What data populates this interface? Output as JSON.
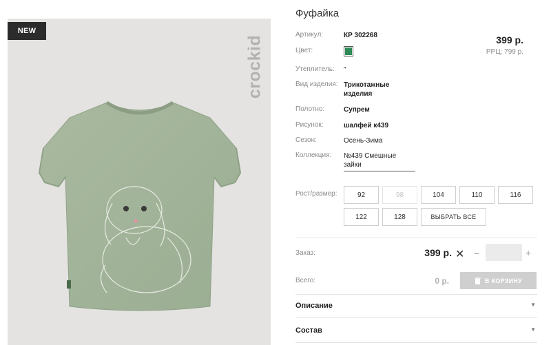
{
  "product": {
    "title": "Фуфайка",
    "badge": "NEW",
    "brand": "crockid",
    "price": "399 р.",
    "rrc": "РРЦ: 799 р."
  },
  "specs": {
    "article_label": "Артикул:",
    "article_value": "КР 302268",
    "color_label": "Цвет:",
    "color_hex": "#2e8b57",
    "insulation_label": "Утеплитель:",
    "insulation_value": "\"",
    "type_label": "Вид изделия:",
    "type_value_line1": "Трикотажные",
    "type_value_line2": "изделия",
    "fabric_label": "Полотно:",
    "fabric_value": "Супрем",
    "pattern_label": "Рисунок:",
    "pattern_value": "шалфей к439",
    "season_label": "Сезон:",
    "season_value": "Осень-Зима",
    "collection_label": "Коллекция:",
    "collection_line1": "№439 Смешные",
    "collection_line2": "зайки"
  },
  "sizes": {
    "label": "Рост/размер:",
    "options": [
      "92",
      "98",
      "104",
      "110",
      "116",
      "122",
      "128"
    ],
    "select_all": "ВЫБРАТЬ ВСЕ"
  },
  "order": {
    "order_label": "Заказ:",
    "order_price": "399 р.",
    "times": "✕",
    "minus": "−",
    "plus": "+",
    "total_label": "Всего:",
    "total_value": "0 р.",
    "cart_button": "В КОРЗИНУ"
  },
  "accordion": {
    "description": "Описание",
    "composition": "Состав"
  }
}
